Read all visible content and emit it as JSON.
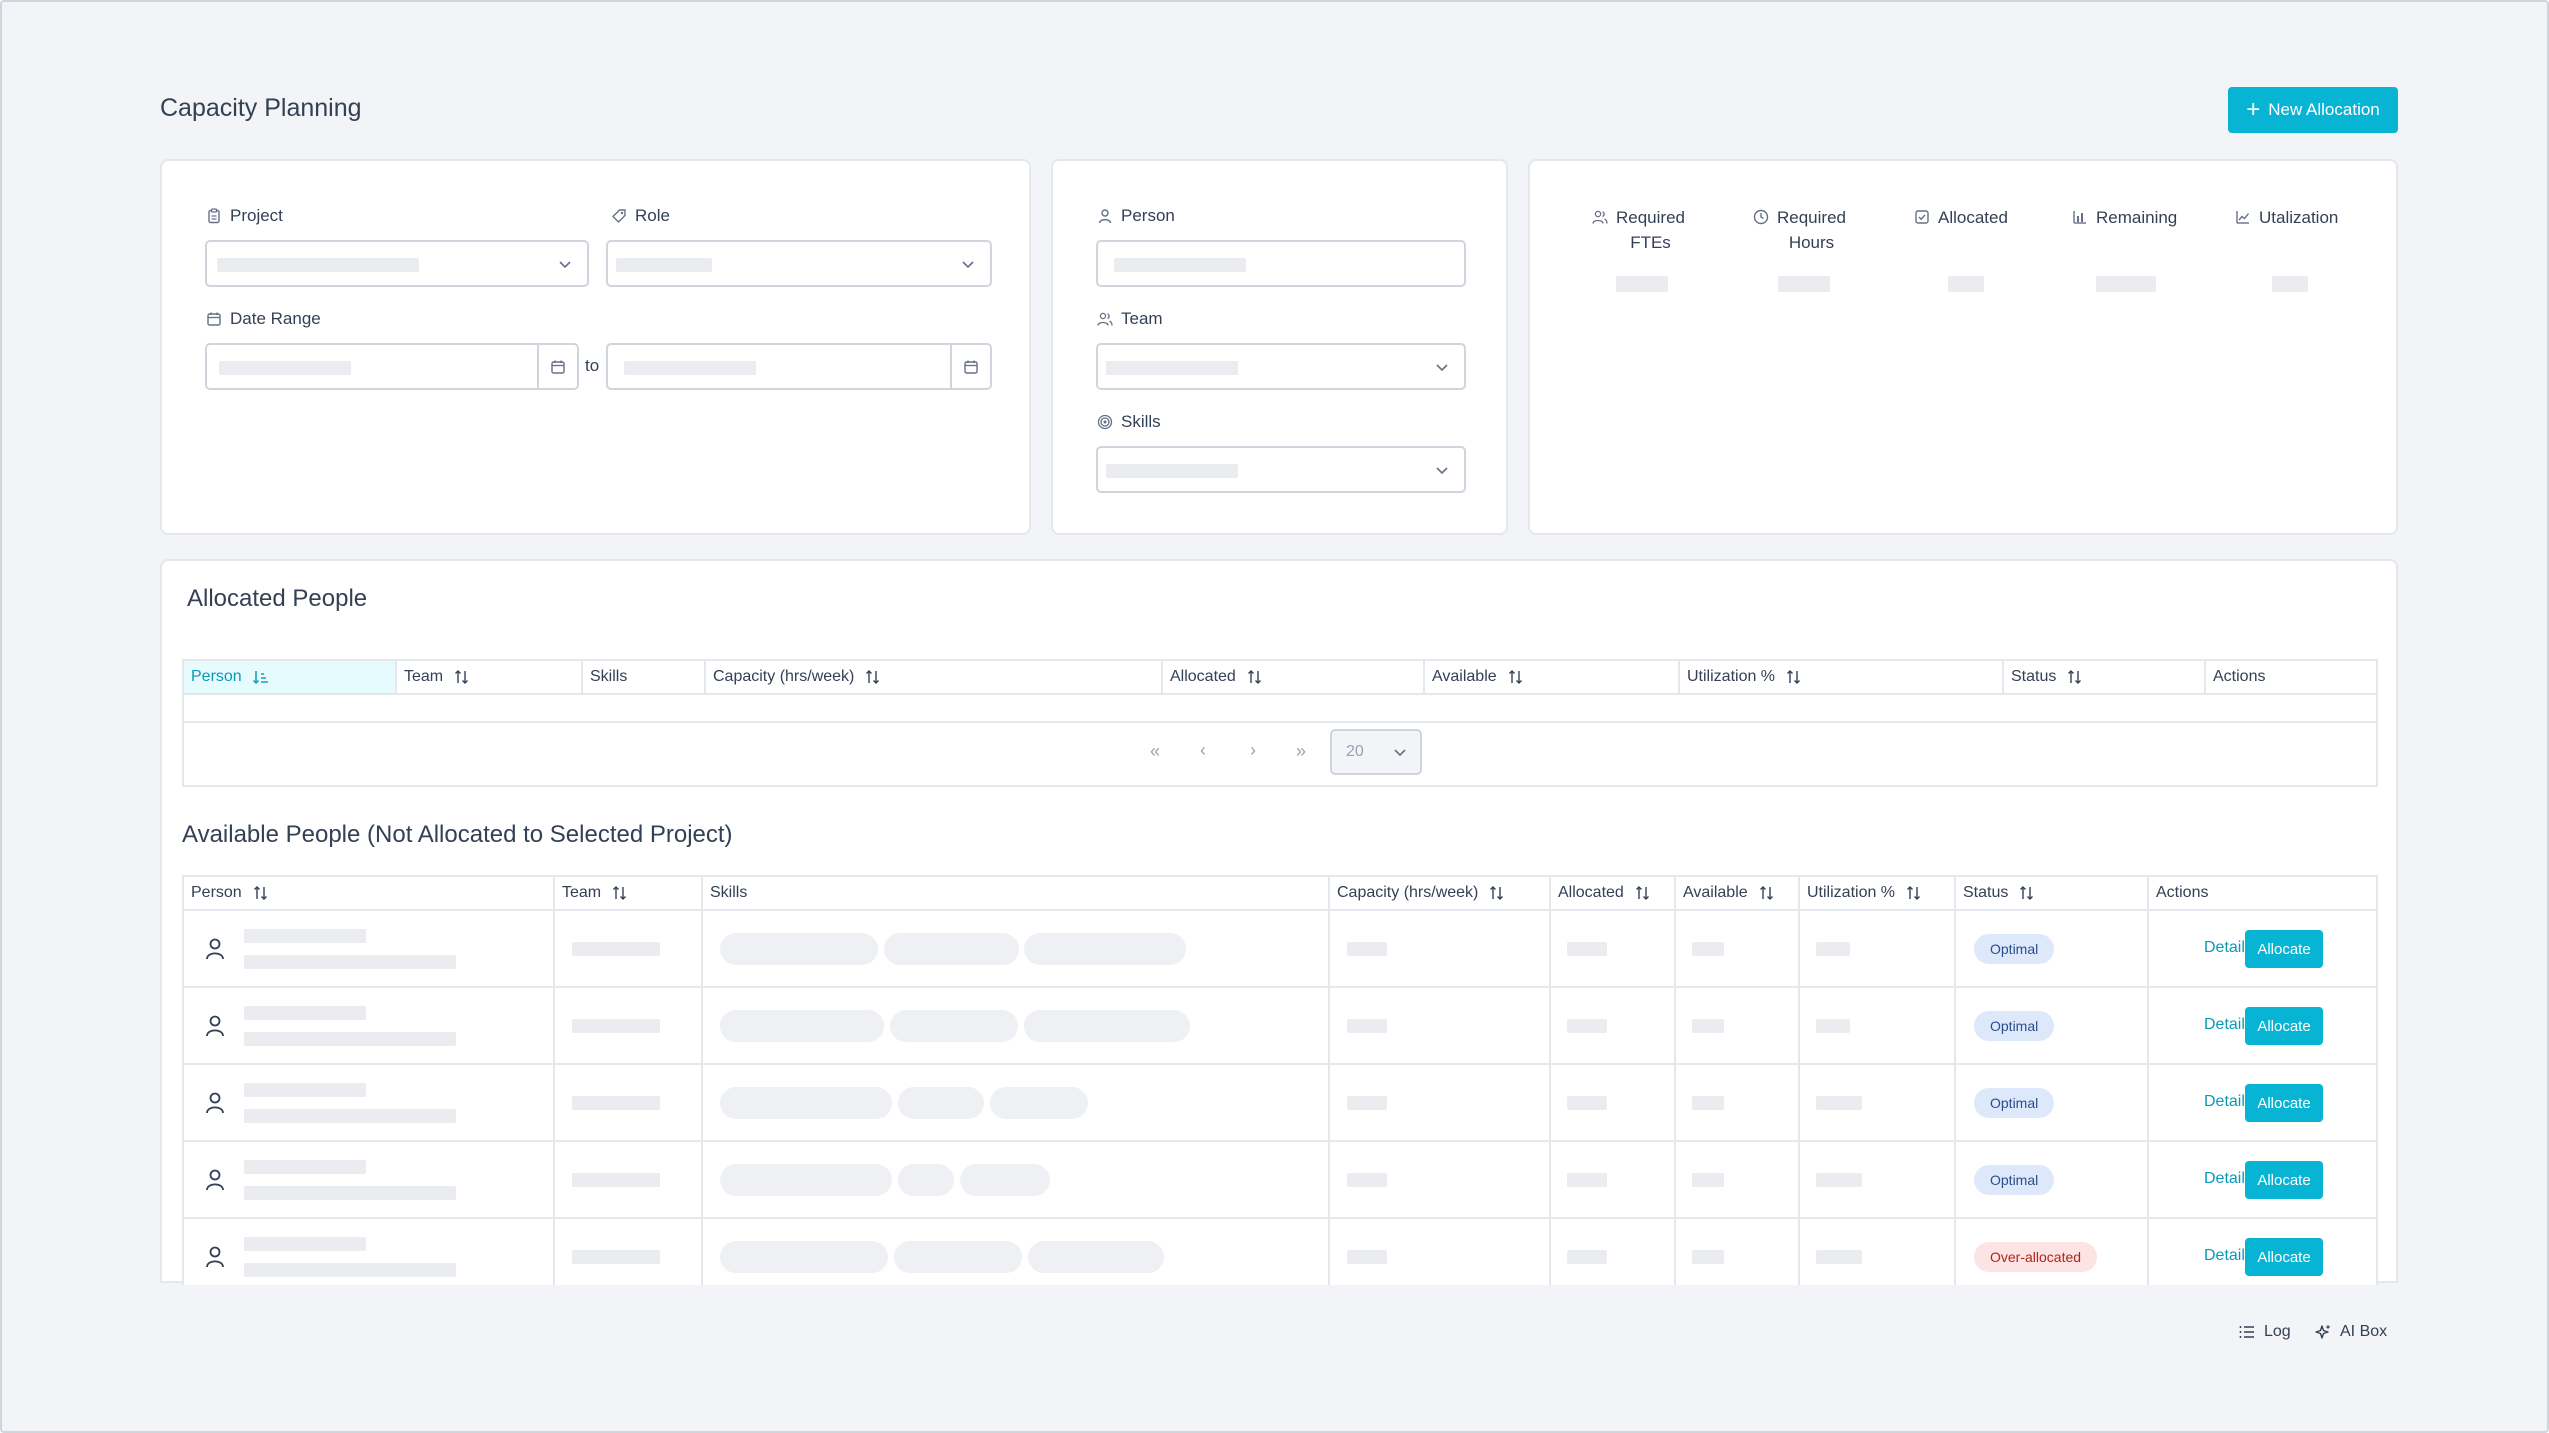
{
  "header": {
    "title": "Capacity Planning",
    "new_allocation_label": "New Allocation"
  },
  "filters": {
    "project_label": "Project",
    "role_label": "Role",
    "date_range_label": "Date Range",
    "to_label": "to",
    "person_label": "Person",
    "team_label": "Team",
    "skills_label": "Skills"
  },
  "stats": {
    "required_ftes_line1": "Required",
    "required_ftes_line2": "FTEs",
    "required_hours_line1": "Required",
    "required_hours_line2": "Hours",
    "allocated": "Allocated",
    "remaining": "Remaining",
    "utilization": "Utalization"
  },
  "allocated_section": {
    "title": "Allocated People",
    "columns": [
      "Person",
      "Team",
      "Skills",
      "Capacity (hrs/week)",
      "Allocated",
      "Available",
      "Utilization %",
      "Status",
      "Actions"
    ],
    "page_size": "20"
  },
  "available_section": {
    "title": "Available People (Not Allocated to Selected Project)",
    "columns": [
      "Person",
      "Team",
      "Skills",
      "Capacity (hrs/week)",
      "Allocated",
      "Available",
      "Utilization %",
      "Status",
      "Actions"
    ],
    "rows": [
      {
        "status": "Optimal",
        "details": "Details",
        "allocate": "Allocate"
      },
      {
        "status": "Optimal",
        "details": "Details",
        "allocate": "Allocate"
      },
      {
        "status": "Optimal",
        "details": "Details",
        "allocate": "Allocate"
      },
      {
        "status": "Optimal",
        "details": "Details",
        "allocate": "Allocate"
      },
      {
        "status": "Over-allocated",
        "details": "Details",
        "allocate": "Allocate"
      }
    ]
  },
  "footer": {
    "log_label": "Log",
    "ai_box_label": "AI Box"
  },
  "colors": {
    "accent": "#08b4d4",
    "optimal_badge": "#dde9fb",
    "over_badge": "#fde4e4"
  }
}
